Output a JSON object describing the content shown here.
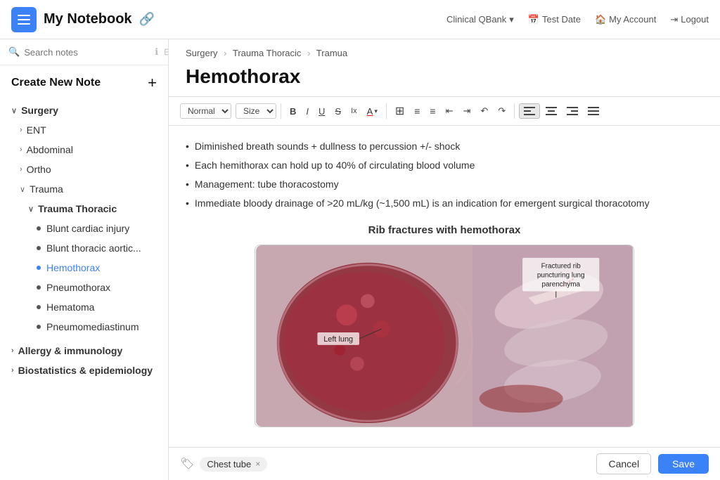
{
  "header": {
    "menu_label": "Menu",
    "title": "My Notebook",
    "nav_items": [
      {
        "label": "Clinical QBank",
        "icon": "chevron-down-icon",
        "has_dropdown": true
      },
      {
        "label": "Test Date",
        "icon": "calendar-icon"
      },
      {
        "label": "My Account",
        "icon": "home-icon"
      },
      {
        "label": "Logout",
        "icon": "logout-icon"
      }
    ]
  },
  "sidebar": {
    "search_placeholder": "Search notes",
    "create_label": "Create New Note",
    "create_plus": "+",
    "nav": [
      {
        "level": 0,
        "label": "Surgery",
        "type": "chevron-open",
        "id": "surgery"
      },
      {
        "level": 1,
        "label": "ENT",
        "type": "chevron-closed",
        "id": "ent"
      },
      {
        "level": 1,
        "label": "Abdominal",
        "type": "chevron-closed",
        "id": "abdominal"
      },
      {
        "level": 1,
        "label": "Ortho",
        "type": "chevron-closed",
        "id": "ortho"
      },
      {
        "level": 1,
        "label": "Trauma",
        "type": "chevron-open",
        "id": "trauma"
      },
      {
        "level": 2,
        "label": "Trauma Thoracic",
        "type": "chevron-open",
        "id": "trauma-thoracic"
      },
      {
        "level": 3,
        "label": "Blunt cardiac injury",
        "type": "bullet",
        "id": "blunt-cardiac"
      },
      {
        "level": 3,
        "label": "Blunt thoracic aortic...",
        "type": "bullet",
        "id": "blunt-thoracic"
      },
      {
        "level": 3,
        "label": "Hemothorax",
        "type": "bullet",
        "id": "hemothorax",
        "active": true
      },
      {
        "level": 3,
        "label": "Pneumothorax",
        "type": "bullet",
        "id": "pneumothorax"
      },
      {
        "level": 3,
        "label": "Hematoma",
        "type": "bullet",
        "id": "hematoma"
      },
      {
        "level": 3,
        "label": "Pneumomediastinum",
        "type": "bullet",
        "id": "pneumomediastinum"
      },
      {
        "level": 0,
        "label": "Allergy & immunology",
        "type": "chevron-closed",
        "id": "allergy"
      },
      {
        "level": 0,
        "label": "Biostatistics & epidemiology",
        "type": "chevron-closed",
        "id": "biostats"
      }
    ]
  },
  "content": {
    "breadcrumb": [
      "Surgery",
      "Trauma Thoracic",
      "Tramua"
    ],
    "breadcrumb_seps": [
      ">",
      ">"
    ],
    "title": "Hemothorax",
    "toolbar": {
      "style_label": "Normal",
      "size_label": "Size",
      "bold": "B",
      "italic": "I",
      "underline": "U",
      "strikethrough": "S",
      "subscript": "Ix",
      "font_color": "A",
      "table": "⊞",
      "ordered_list": "≡",
      "unordered_list": "≡",
      "indent_left": "⇤",
      "indent_right": "⇥",
      "undo": "↶",
      "redo": "↷",
      "align_left": "⬛",
      "align_center": "⬛",
      "align_right": "⬛",
      "align_justify": "⬛"
    },
    "bullets": [
      "Diminished breath sounds + dullness to percussion +/- shock",
      "Each hemithorax can hold up to 40% of circulating blood volume",
      "Management: tube thoracostomy",
      "Immediate bloody drainage of >20 mL/kg (~1,500 mL) is an indication for emergent surgical thoracotomy"
    ],
    "image_title": "Rib fractures with hemothorax",
    "image_labels": {
      "left_lung": "Left lung",
      "fracture": "Fractured rib\npuncturing lung\nparenchyma"
    }
  },
  "footer": {
    "tag_icon": "🏷",
    "tag_label": "Chest tube",
    "tag_remove": "×",
    "cancel_label": "Cancel",
    "save_label": "Save"
  }
}
